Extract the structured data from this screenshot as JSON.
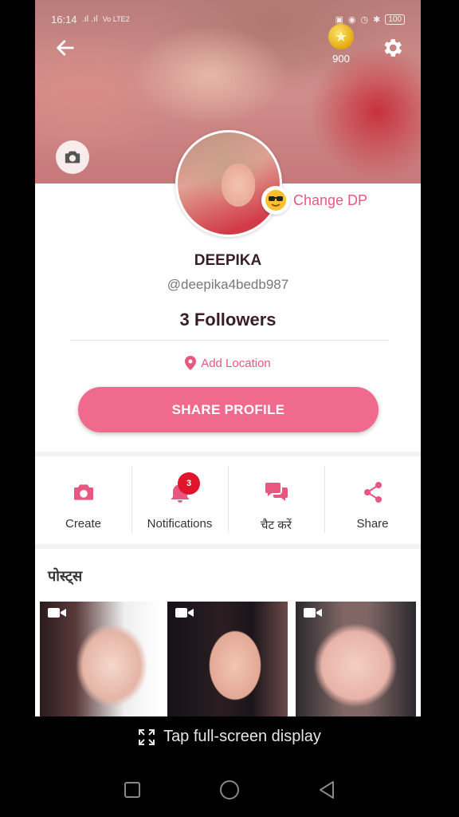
{
  "status_bar": {
    "time": "16:14",
    "signal": ".ıl .ıl",
    "network": "Vo LTE2",
    "battery": "100"
  },
  "header": {
    "coin_count": "900"
  },
  "profile": {
    "change_dp_label": "Change DP",
    "name": "DEEPIKA",
    "handle": "@deepika4bedb987",
    "followers": "3 Followers",
    "add_location": "Add Location",
    "share_button": "SHARE PROFILE"
  },
  "actions": [
    {
      "label": "Create",
      "icon": "camera-icon"
    },
    {
      "label": "Notifications",
      "icon": "bell-icon",
      "badge": "3"
    },
    {
      "label": "चैट करें",
      "icon": "chat-icon"
    },
    {
      "label": "Share",
      "icon": "share-icon"
    }
  ],
  "posts": {
    "title": "पोस्ट्स"
  },
  "overlay": {
    "fullscreen_hint": "Tap full-screen display"
  },
  "colors": {
    "accent": "#e8577f",
    "button": "#f06a8e",
    "badge": "#e0152b"
  }
}
